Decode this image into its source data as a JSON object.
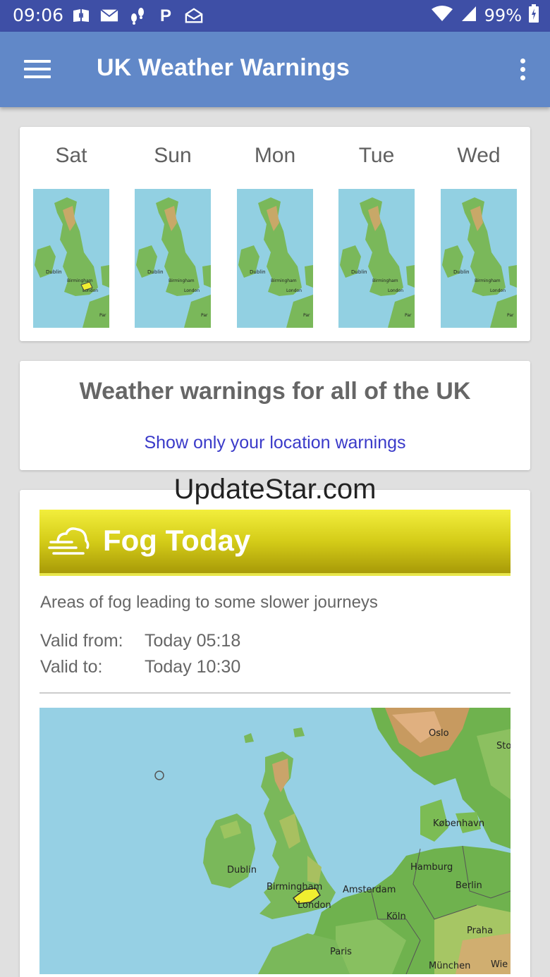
{
  "status_bar": {
    "time": "09:06",
    "battery": "99%"
  },
  "app_bar": {
    "title": "UK Weather Warnings"
  },
  "days": [
    {
      "label": "Sat"
    },
    {
      "label": "Sun"
    },
    {
      "label": "Mon"
    },
    {
      "label": "Tue"
    },
    {
      "label": "Wed"
    }
  ],
  "map_labels": {
    "dublin": "Dublin",
    "birmingham": "Birmingham",
    "london": "London",
    "paris": "Paris",
    "amsterdam": "Amsterdam",
    "hamburg": "Hamburg",
    "berlin": "Berlin",
    "koln": "Köln",
    "kobenhavn": "København",
    "oslo": "Oslo",
    "praha": "Praha",
    "munchen": "München",
    "sto": "Sto",
    "wie": "Wie",
    "par_short": "Par",
    "a_short": "A"
  },
  "warnings_card": {
    "heading": "Weather warnings for all of the UK",
    "link": "Show only your location warnings"
  },
  "watermark": "UpdateStar.com",
  "warning": {
    "title": "Fog Today",
    "icon": "fog-icon",
    "color": "#e6e020",
    "description": "Areas of fog leading to some slower journeys",
    "valid_from_label": "Valid from:",
    "valid_from": "Today 05:18",
    "valid_to_label": "Valid to:",
    "valid_to": "Today 10:30"
  }
}
